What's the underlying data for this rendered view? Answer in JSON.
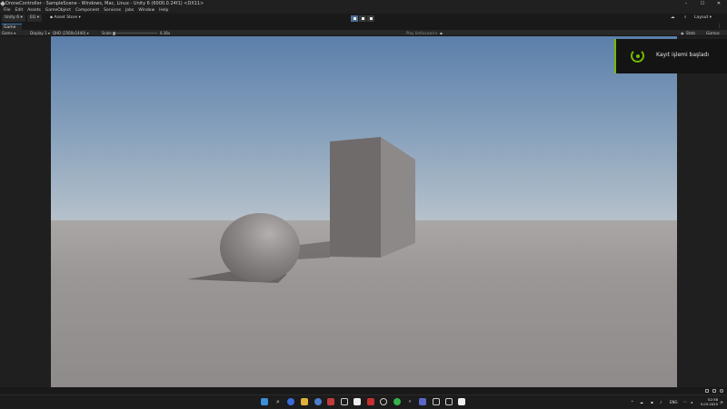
{
  "window": {
    "title": "DroneController - SampleScene - Windows, Mac, Linux - Unity 6 (6000.0.24f1) <DX11>",
    "controls": [
      "–",
      "☐",
      "✕"
    ]
  },
  "menu": [
    "File",
    "Edit",
    "Assets",
    "GameObject",
    "Component",
    "Services",
    "Jobs",
    "Window",
    "Help"
  ],
  "toolbar": {
    "account_label": "Unity 6",
    "user_initials": "EG",
    "asset_store_label": "Asset Store",
    "layout_label": "Layout"
  },
  "tabs": [
    {
      "label": "Game"
    }
  ],
  "game_toolbar": {
    "view_mode": "Game",
    "display": "Display 1",
    "resolution": "QHD (2560x1440)",
    "scale_label": "Scale",
    "scale_value": "0.36x",
    "play_mode": "Play Unfocused",
    "stats_label": "Stats",
    "gizmos_label": "Gizmos"
  },
  "notification": {
    "message": "Kayıt işlemi başladı",
    "icon": "recording-icon",
    "accent_color": "#76b900"
  },
  "taskbar": {
    "language": "ENG",
    "time": "02:38",
    "date": "3.03.2025",
    "icons": [
      "windows-start-icon",
      "search-icon",
      "copilot-icon",
      "file-explorer-icon",
      "chrome-icon",
      "store-icon",
      "app-icon",
      "unity-icon",
      "app-icon",
      "youtube-icon",
      "settings-icon",
      "app-icon",
      "whatsapp-icon",
      "teams-icon",
      "app-icon",
      "app-icon",
      "app-icon",
      "capcut-icon"
    ]
  },
  "colors": {
    "editor_bg": "#191919",
    "play_active": "#4d6c8f",
    "tab_accent": "#3a79bb"
  }
}
